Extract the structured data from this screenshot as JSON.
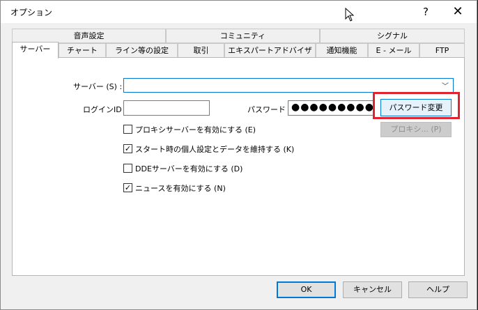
{
  "window": {
    "title": "オプション",
    "help_glyph": "?",
    "close_glyph": "✕"
  },
  "tabs_top": [
    {
      "label": "音声設定"
    },
    {
      "label": "コミュニティ"
    },
    {
      "label": "シグナル"
    }
  ],
  "tabs_bottom": [
    {
      "label": "サーバー",
      "active": true
    },
    {
      "label": "チャート"
    },
    {
      "label": "ライン等の設定"
    },
    {
      "label": "取引"
    },
    {
      "label": "エキスパートアドバイザ"
    },
    {
      "label": "通知機能"
    },
    {
      "label": "E - メール"
    },
    {
      "label": "FTP"
    }
  ],
  "server": {
    "server_label": "サーバー (S) :",
    "server_value": "",
    "login_label": "ログインID :",
    "login_value": "",
    "password_label": "パスワード :",
    "password_dots": "●●●●●●●●●●●●",
    "change_password_button": "パスワード変更",
    "proxy_button": "プロキシ... (P)"
  },
  "options": [
    {
      "label": "プロキシサーバーを有効にする (E)",
      "checked": false
    },
    {
      "label": "スタート時の個人設定とデータを維持する (K)",
      "checked": true
    },
    {
      "label": "DDEサーバーを有効にする (D)",
      "checked": false
    },
    {
      "label": "ニュースを有効にする (N)",
      "checked": true
    }
  ],
  "footer": {
    "ok": "OK",
    "cancel": "キャンセル",
    "help": "ヘルプ"
  },
  "colors": {
    "highlight": "#e0232e",
    "focus": "#0078d7"
  }
}
